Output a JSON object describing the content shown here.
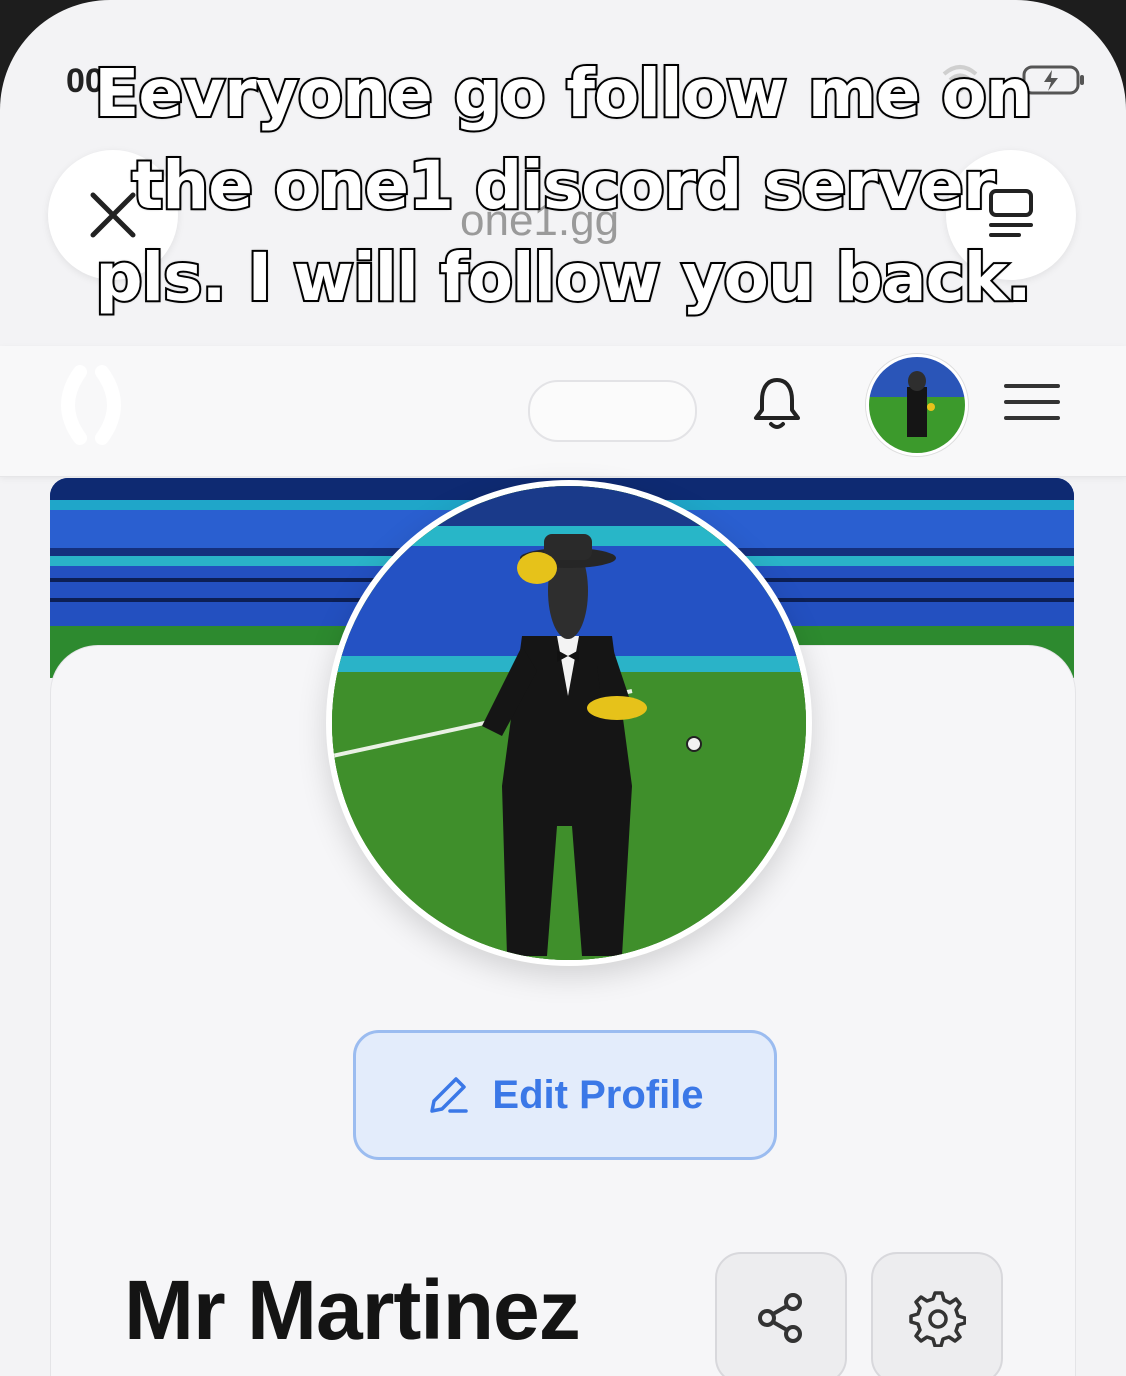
{
  "status_bar": {
    "time": "00:"
  },
  "browser": {
    "url_fragment": "one1.gg",
    "close_icon": "close-icon",
    "reader_icon": "reader-mode-icon"
  },
  "site_header": {
    "logo_icon": "one1-logo-icon",
    "bell_icon": "bell-icon",
    "menu_icon": "hamburger-menu-icon"
  },
  "profile": {
    "name": "Mr Martinez",
    "edit_label": "Edit Profile",
    "accent": "#3b78e7"
  },
  "caption": {
    "text": "Eevryone go follow me on the one1 discord server pls. I will follow you back."
  }
}
